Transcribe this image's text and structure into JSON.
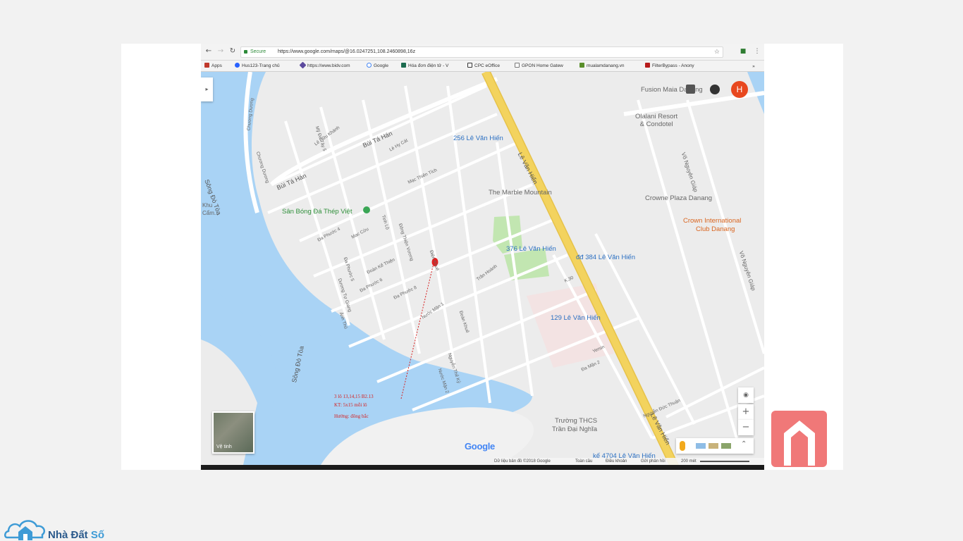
{
  "browser": {
    "secure_label": "Secure",
    "url": "https://www.google.com/maps/@16.0247251,108.2460898,16z",
    "bookmarks": [
      {
        "label": "Apps"
      },
      {
        "label": "Hus123-Trang chủ"
      },
      {
        "label": "https://www.bidv.com"
      },
      {
        "label": "Google"
      },
      {
        "label": "Hóa đơn điện tử - V"
      },
      {
        "label": "CPC eOffice"
      },
      {
        "label": "GPON Home Gatew"
      },
      {
        "label": "mualamdanang.vn"
      },
      {
        "label": "FilterBypass - Anony"
      }
    ],
    "more_bookmarks": "»"
  },
  "map": {
    "user_avatar": "H",
    "places": {
      "fusion_maia": "Fusion Maia Danang",
      "olalani": "Olalani Resort\n& Condotel",
      "hien_256": "256 Lê Văn Hiến",
      "marble_mountain": "The Marble Mountain",
      "crowne_plaza": "Crowne Plaza Danang",
      "crown_club_1": "Crown International",
      "crown_club_2": "Club Danang",
      "stadium": "Sân Bóng Đá Thép Việt",
      "hien_376": "376 Lê Văn Hiến",
      "hien_384": "đđ 384 Lê Văn Hiến",
      "hien_129": "129 Lê Văn Hiến",
      "school_1": "Trường THCS",
      "school_2": "Trần Đại Nghĩa",
      "hien_4704": "kế 4704 Lê Văn Hiến",
      "khu_cam": "Khu\nCẩm..."
    },
    "streets": {
      "le_van_hien_1": "Lê Văn Hiến",
      "le_van_hien_2": "Lê Văn Hiến",
      "bui_ta_han_1": "Bùi Tá Hán",
      "bui_ta_han_2": "Bùi Tá Hán",
      "song_do_toa_1": "Sông Đò Tòa",
      "song_do_toa_2": "Sông Đò Tòa",
      "chuong_duong_1": "Chương Dương",
      "chuong_duong_2": "Chương Dương",
      "vo_nguyen_giap_1": "Võ Nguyên Giáp",
      "vo_nguyen_giap_2": "Võ Nguyên Giáp",
      "tran_hoanh": "Trần Hoành",
      "mac_thien_tich": "Mạc Thiên Tích",
      "dien_khue": "Điện Khuê",
      "doan_khue": "Đoàn Khuê",
      "nuoc_man_1": "Nước Mặn 1",
      "nuoc_man_2": "Nước Mặn 2",
      "dong_thien_vuong": "Đông Thiện Vương",
      "ton_thu_huong": "Đa Phước 8",
      "da_phuoc_4": "Đa Phước 4",
      "da_phuoc_5": "Đa Phước 5",
      "da_phuoc_6": "Đa Phước 6",
      "doan_ke_thien": "Đoàn Kế Thiện",
      "mac_cuu": "Mạc Cửu",
      "anh_thu": "Ánh Thủ",
      "duong_tu_giang": "Dương Tự Giang",
      "le_huu_khanh": "Lê Hữu Khánh",
      "le_hy_cat": "Lê Hy Cát",
      "my_da_tay_5": "Mỹ Đa Tây 5",
      "nguyen_duc_thuan": "Nguyễn Đức Thuận",
      "yersin": "Yersin",
      "da_man_2": "Đa Mặn 2",
      "k30": "K.30",
      "nguyen_the_ky": "Nguyễn Thế Kỷ",
      "tinh_lo": "Tinh Lộ"
    },
    "annotation": {
      "line1": "3 lô 13,14,15 B2.13",
      "line2": "KT: 5x15 mỗi lô",
      "line3": "Hướng: đông bắc"
    },
    "google_logo": "Google",
    "satellite_label": "Vệ tinh",
    "zoom_in": "+",
    "zoom_out": "−",
    "footer": {
      "data": "Dữ liệu bản đồ ©2018 Google",
      "global": "Toàn cầu",
      "terms": "Điều khoản",
      "feedback": "Gửi phản hồi",
      "scale": "200 mét"
    },
    "colors": {
      "highway": "#f3d35e",
      "water": "#a9d3f5",
      "park": "#c2e6b1",
      "pin": "#e41e1e"
    }
  },
  "branding": {
    "logo_main": "Nhà Đất ",
    "logo_accent": "Số"
  }
}
